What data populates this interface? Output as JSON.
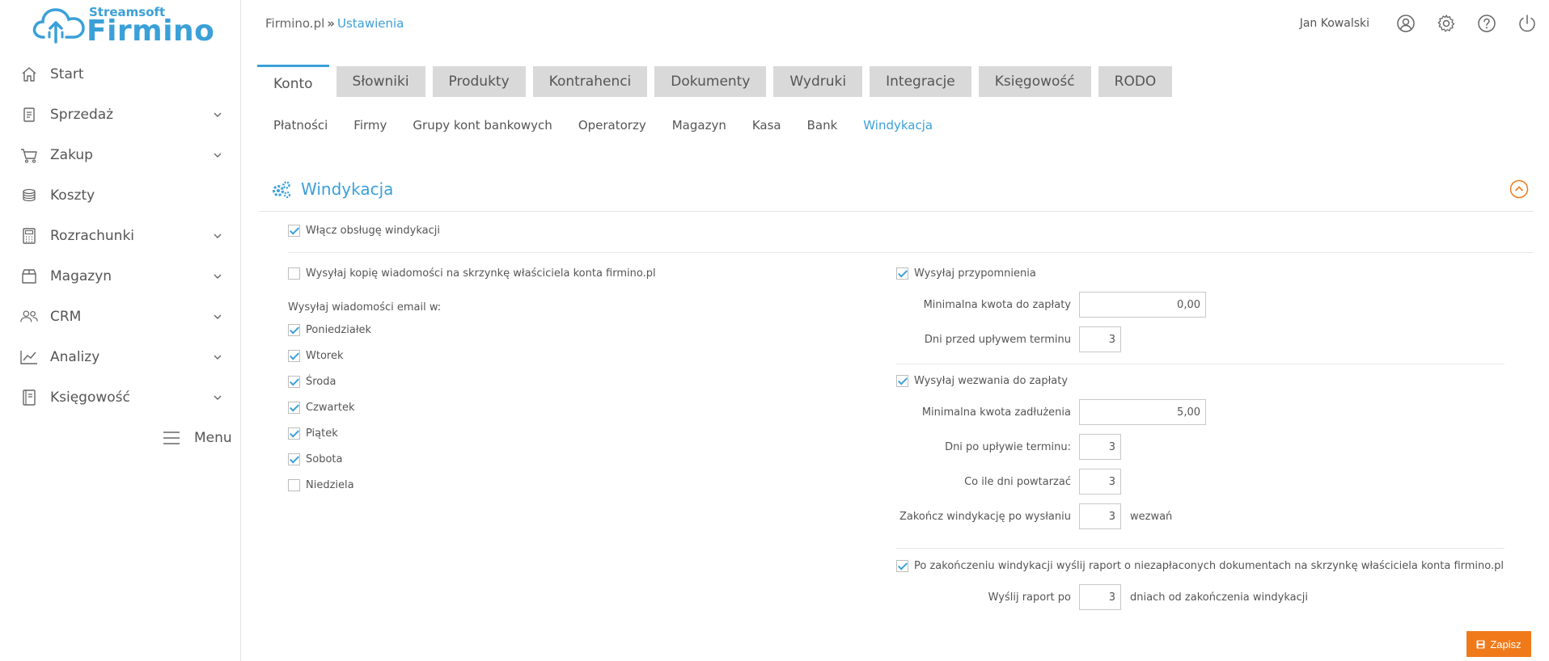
{
  "logo": {
    "small": "Streamsoft",
    "big": "Firmino"
  },
  "sidebar": {
    "items": [
      {
        "label": "Start",
        "icon": "home-icon",
        "has_chevron": false
      },
      {
        "label": "Sprzedaż",
        "icon": "document-icon",
        "has_chevron": true
      },
      {
        "label": "Zakup",
        "icon": "cart-icon",
        "has_chevron": true
      },
      {
        "label": "Koszty",
        "icon": "coins-icon",
        "has_chevron": false
      },
      {
        "label": "Rozrachunki",
        "icon": "calculator-icon",
        "has_chevron": true
      },
      {
        "label": "Magazyn",
        "icon": "box-icon",
        "has_chevron": true
      },
      {
        "label": "CRM",
        "icon": "users-icon",
        "has_chevron": true
      },
      {
        "label": "Analizy",
        "icon": "chart-icon",
        "has_chevron": true
      },
      {
        "label": "Księgowość",
        "icon": "book-icon",
        "has_chevron": true
      }
    ],
    "menu_label": "Menu"
  },
  "breadcrumb": {
    "root": "Firmino.pl",
    "separator": "»",
    "current": "Ustawienia"
  },
  "user": {
    "name": "Jan Kowalski"
  },
  "tabs": [
    "Konto",
    "Słowniki",
    "Produkty",
    "Kontrahenci",
    "Dokumenty",
    "Wydruki",
    "Integracje",
    "Księgowość",
    "RODO"
  ],
  "active_tab": "Konto",
  "subtabs": [
    "Płatności",
    "Firmy",
    "Grupy kont bankowych",
    "Operatorzy",
    "Magazyn",
    "Kasa",
    "Bank",
    "Windykacja"
  ],
  "active_subtab": "Windykacja",
  "section": {
    "title": "Windykacja",
    "enable_label": "Włącz obsługę windykacji",
    "enable_checked": true,
    "copy_label": "Wysyłaj kopię wiadomości na skrzynkę właściciela konta firmino.pl",
    "copy_checked": false,
    "days_heading": "Wysyłaj wiadomości email w:",
    "days": [
      {
        "label": "Poniedziałek",
        "checked": true
      },
      {
        "label": "Wtorek",
        "checked": true
      },
      {
        "label": "Środa",
        "checked": true
      },
      {
        "label": "Czwartek",
        "checked": true
      },
      {
        "label": "Piątek",
        "checked": true
      },
      {
        "label": "Sobota",
        "checked": true
      },
      {
        "label": "Niedziela",
        "checked": false
      }
    ],
    "reminders": {
      "label": "Wysyłaj przypomnienia",
      "checked": true,
      "min_amount_label": "Minimalna kwota do zapłaty",
      "min_amount_value": "0,00",
      "days_before_label": "Dni przed upływem terminu",
      "days_before_value": "3"
    },
    "demands": {
      "label": "Wysyłaj wezwania do zapłaty",
      "checked": true,
      "min_debt_label": "Minimalna kwota zadłużenia",
      "min_debt_value": "5,00",
      "days_after_label": "Dni po upływie terminu:",
      "days_after_value": "3",
      "repeat_label": "Co ile dni powtarzać",
      "repeat_value": "3",
      "finish_label": "Zakończ windykację po wysłaniu",
      "finish_value": "3",
      "finish_suffix": "wezwań"
    },
    "report": {
      "label": "Po zakończeniu windykacji wyślij raport o niezapłaconych dokumentach na skrzynkę właściciela konta firmino.pl",
      "checked": true,
      "send_after_label": "Wyślij raport po",
      "send_after_value": "3",
      "send_after_suffix": "dniach od zakończenia windykacji"
    }
  },
  "save_label": "Zapisz",
  "colors": {
    "accent": "#3ba0d8",
    "save": "#f07a1a",
    "collapse": "#f07a1a"
  }
}
